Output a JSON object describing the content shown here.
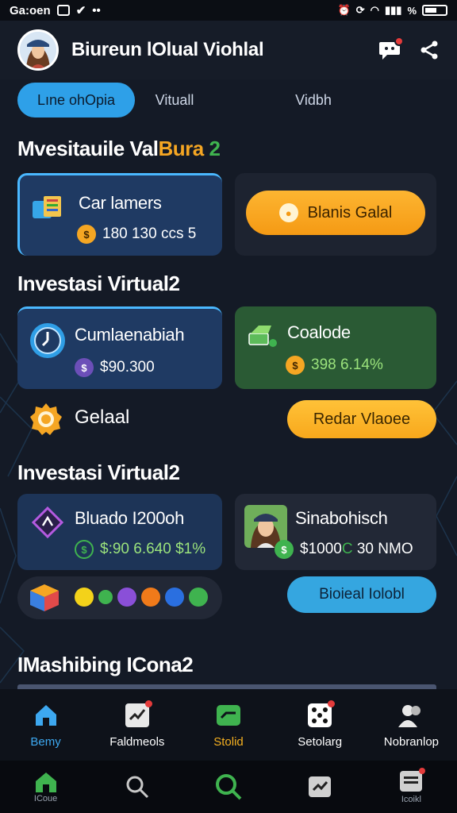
{
  "status_bar": {
    "carrier": "Ga:oen",
    "right_text": "%"
  },
  "header": {
    "title": "Biureun lOlual Viohlal",
    "notification_icon": "chat-bubble-icon",
    "share_icon": "share-icon"
  },
  "tabs": [
    {
      "label": "Lıne ohOpia",
      "active": true
    },
    {
      "label": "Vituall",
      "active": false
    },
    {
      "label": "Vidbh",
      "active": false
    }
  ],
  "section1": {
    "title_white": "Mvesitauile Val",
    "title_orange": "Bura",
    "title_green": "2",
    "card1": {
      "title": "Car lamers",
      "value": "180 130 ccs 5"
    },
    "button": "Blanis Galal"
  },
  "section2": {
    "title": "Investasi Virtual2",
    "card1": {
      "title": "Cumlaenabiah",
      "value": "$90.300"
    },
    "card2": {
      "title": "Coalode",
      "value": "398 6.14%"
    },
    "goal_label": "Gelaal",
    "button": "Redar Vlaoee"
  },
  "section3": {
    "title": "Investasi Virtual2",
    "card1": {
      "title": "Bluado I200oh",
      "value": "$:90 6.640 $1%"
    },
    "card2": {
      "title": "Sinabohisch",
      "value_white": "$1000",
      "value_green": "C",
      "value_rest": " 30 NMO"
    },
    "button": "Bioieal Iolobl"
  },
  "section4": {
    "title": "IMashibing ICona2"
  },
  "nav_top": [
    {
      "label": "Bemy",
      "icon": "home-icon",
      "color": "#3da8f0"
    },
    {
      "label": "Faldmeols",
      "icon": "chart-icon",
      "color": "#ffffff"
    },
    {
      "label": "Stolid",
      "icon": "wallet-icon",
      "color": "#f5b020"
    },
    {
      "label": "Setolarg",
      "icon": "dice-icon",
      "color": "#ffffff"
    },
    {
      "label": "Nobranlop",
      "icon": "people-icon",
      "color": "#ffffff"
    }
  ],
  "nav_bottom": [
    {
      "label": "ICoue",
      "icon": "home-icon"
    },
    {
      "label": "",
      "icon": "search-icon"
    },
    {
      "label": "",
      "icon": "search-icon"
    },
    {
      "label": "",
      "icon": "chart-icon"
    },
    {
      "label": "Icoikl",
      "icon": "list-icon"
    }
  ],
  "colors": {
    "accent_blue": "#2ea0e8",
    "accent_orange": "#f59a14",
    "accent_green": "#3fb34f",
    "background": "#141a26"
  }
}
